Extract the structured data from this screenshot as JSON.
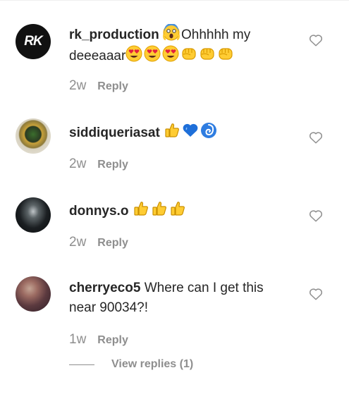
{
  "comments": [
    {
      "username": "rk_production",
      "avatar_text": "RK",
      "text_before": "",
      "text": "Ohhhhh my deeeaaar",
      "emoji_lead": [
        "screaming-face"
      ],
      "emoji": [
        "heart-eyes-face",
        "heart-eyes-face",
        "heart-eyes-face",
        "fist",
        "fist",
        "fist"
      ],
      "age": "2w",
      "reply_label": "Reply"
    },
    {
      "username": "siddiqueriasat",
      "text": "",
      "emoji": [
        "thumbs-up",
        "blue-heart",
        "cyclone"
      ],
      "age": "2w",
      "reply_label": "Reply"
    },
    {
      "username": "donnys.o",
      "text": "",
      "emoji": [
        "thumbs-up",
        "thumbs-up",
        "thumbs-up"
      ],
      "age": "2w",
      "reply_label": "Reply"
    },
    {
      "username": "cherryeco5",
      "text": "Where can I get this near 90034?!",
      "emoji": [],
      "age": "1w",
      "reply_label": "Reply",
      "view_replies_label": "View replies (1)"
    }
  ],
  "colors": {
    "text": "#262626",
    "muted": "#8e8e8e",
    "emoji_yellow": "#ffcc33",
    "heart_red": "#e3213d",
    "blue_heart": "#1e6fd9"
  }
}
